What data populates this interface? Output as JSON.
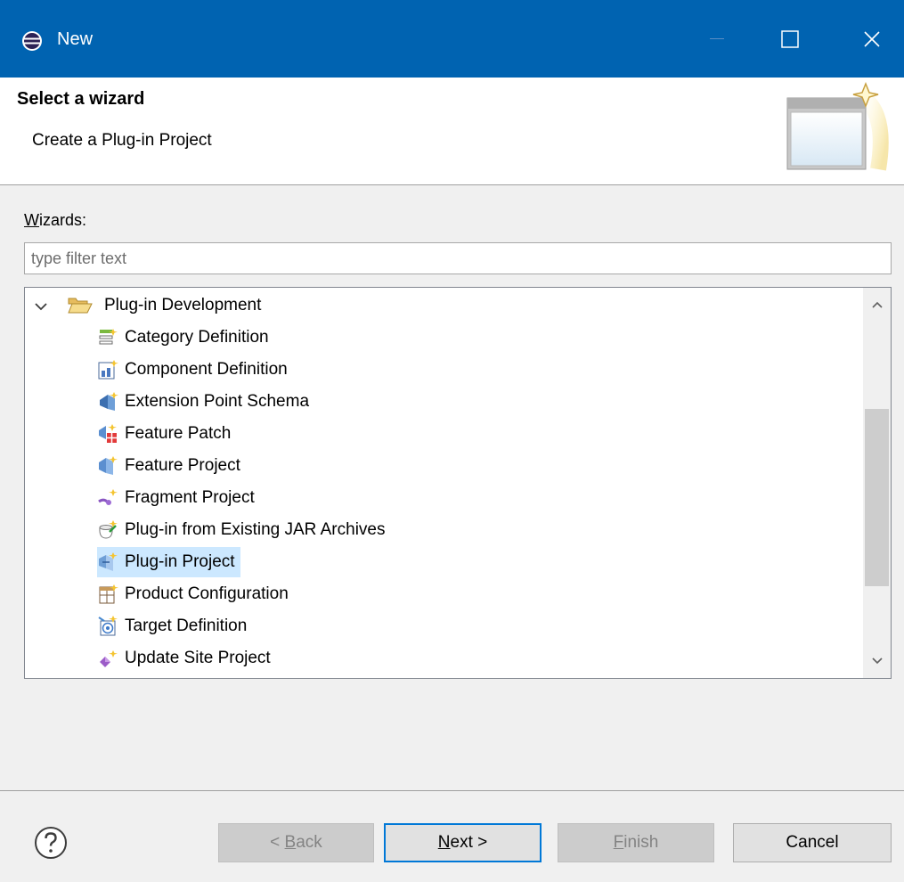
{
  "window": {
    "title": "New",
    "minimize_icon": "minimize-icon",
    "maximize_icon": "maximize-icon",
    "close_icon": "close-icon",
    "accent": "#0063b1"
  },
  "header": {
    "title": "Select a wizard",
    "subtitle": "Create a Plug-in Project"
  },
  "wizards": {
    "label_mnemonic": "W",
    "label_rest": "izards:",
    "filter_placeholder": "type filter text",
    "filter_value": ""
  },
  "tree": {
    "category": {
      "label": "Plug-in Development",
      "expanded": true,
      "icon": "open-folder-icon"
    },
    "items": [
      {
        "label": "Category Definition",
        "icon": "category-definition-icon",
        "selected": false
      },
      {
        "label": "Component Definition",
        "icon": "component-definition-icon",
        "selected": false
      },
      {
        "label": "Extension Point Schema",
        "icon": "extension-point-schema-icon",
        "selected": false
      },
      {
        "label": "Feature Patch",
        "icon": "feature-patch-icon",
        "selected": false
      },
      {
        "label": "Feature Project",
        "icon": "feature-project-icon",
        "selected": false
      },
      {
        "label": "Fragment Project",
        "icon": "fragment-project-icon",
        "selected": false
      },
      {
        "label": "Plug-in from Existing JAR Archives",
        "icon": "plugin-from-jar-icon",
        "selected": false
      },
      {
        "label": "Plug-in Project",
        "icon": "plugin-project-icon",
        "selected": true
      },
      {
        "label": "Product Configuration",
        "icon": "product-configuration-icon",
        "selected": false
      },
      {
        "label": "Target Definition",
        "icon": "target-definition-icon",
        "selected": false
      },
      {
        "label": "Update Site Project",
        "icon": "update-site-project-icon",
        "selected": false
      }
    ],
    "selection_color": "#cce8ff"
  },
  "buttons": {
    "back": {
      "prefix": "< ",
      "mnemonic": "B",
      "rest": "ack",
      "enabled": false
    },
    "next": {
      "mnemonic": "N",
      "rest": "ext >",
      "enabled": true
    },
    "finish": {
      "mnemonic": "F",
      "rest": "inish",
      "enabled": false
    },
    "cancel": {
      "label": "Cancel",
      "enabled": true
    }
  },
  "help_icon": "help-icon"
}
